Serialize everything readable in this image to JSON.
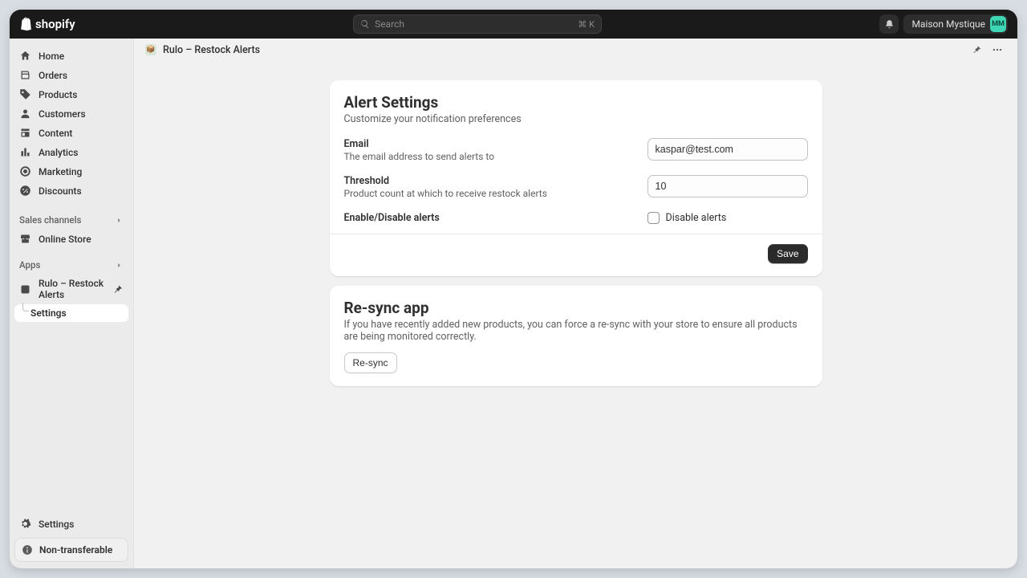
{
  "topbar": {
    "search_placeholder": "Search",
    "search_shortcut": "⌘ K",
    "store_name": "Maison Mystique",
    "store_initials": "MM"
  },
  "sidebar": {
    "nav": [
      {
        "label": "Home"
      },
      {
        "label": "Orders"
      },
      {
        "label": "Products"
      },
      {
        "label": "Customers"
      },
      {
        "label": "Content"
      },
      {
        "label": "Analytics"
      },
      {
        "label": "Marketing"
      },
      {
        "label": "Discounts"
      }
    ],
    "sales_channels_heading": "Sales channels",
    "online_store_label": "Online Store",
    "apps_heading": "Apps",
    "app_name": "Rulo – Restock Alerts",
    "app_sub_settings": "Settings",
    "bottom_settings": "Settings",
    "non_transferable": "Non-transferable"
  },
  "header": {
    "title": "Rulo – Restock Alerts"
  },
  "alert_card": {
    "title": "Alert Settings",
    "subtitle": "Customize your notification preferences",
    "email_label": "Email",
    "email_help": "The email address to send alerts to",
    "email_value": "kaspar@test.com",
    "threshold_label": "Threshold",
    "threshold_help": "Product count at which to receive restock alerts",
    "threshold_value": "10",
    "enable_label": "Enable/Disable alerts",
    "checkbox_label": "Disable alerts",
    "save_label": "Save"
  },
  "resync_card": {
    "title": "Re-sync app",
    "subtitle": "If you have recently added new products, you can force a re-sync with your store to ensure all products are being monitored correctly.",
    "button_label": "Re-sync"
  }
}
